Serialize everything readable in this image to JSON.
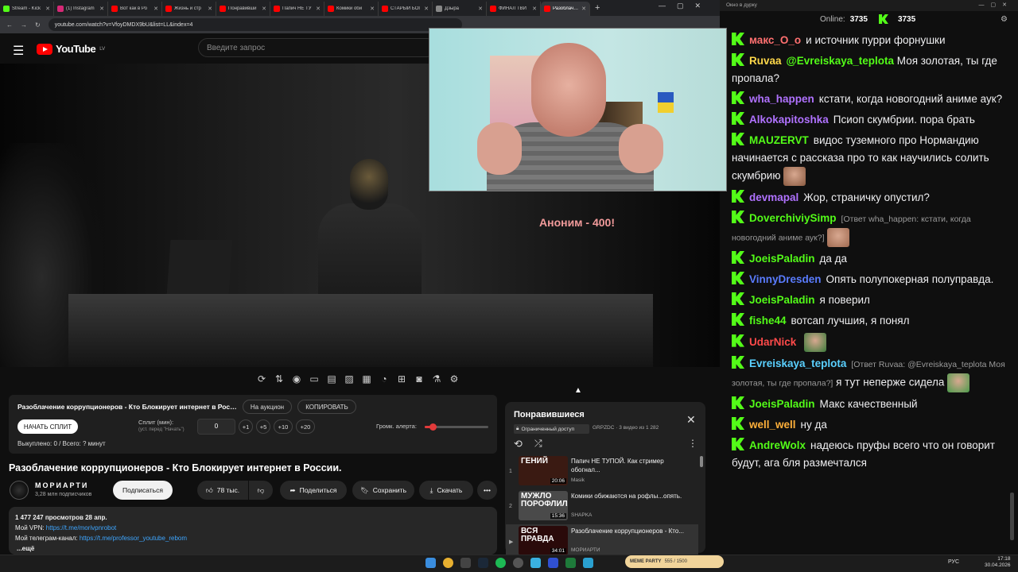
{
  "browser": {
    "tabs": [
      {
        "label": "Stream - Kick",
        "color": "#53fc18"
      },
      {
        "label": "(1) Instagram",
        "color": "#d62976"
      },
      {
        "label": "Вот как в Ро",
        "color": "#f00"
      },
      {
        "label": "Жизнь и стр",
        "color": "#f00"
      },
      {
        "label": "Понравивши",
        "color": "#f00"
      },
      {
        "label": "Папич НЕ ТУ",
        "color": "#f00"
      },
      {
        "label": "Комики оби",
        "color": "#f00"
      },
      {
        "label": "СТАРЫЙ БОГ",
        "color": "#f00"
      },
      {
        "label": "Дзыра",
        "color": "#888"
      },
      {
        "label": "ФИНАЛ ТВИ",
        "color": "#f00"
      },
      {
        "label": "Разоблачени",
        "color": "#f00"
      }
    ],
    "url": "youtube.com/watch?v=VfoyDMDX9bU&list=LL&index=4",
    "window_controls": [
      "—",
      "▢",
      "✕"
    ]
  },
  "youtube": {
    "logo_text": "YouTube",
    "logo_region": "LV",
    "search_placeholder": "Введите запрос"
  },
  "video": {
    "overlay_alert": "Аноним - 400!"
  },
  "split": {
    "title": "Разоблачение коррупционеров - Кто Блокирует интернет в России.",
    "auction_button": "На аукцион",
    "copy_button": "КОПИРОВАТЬ",
    "start_button": "НАЧАТЬ СПЛИТ",
    "split_label": "Сплит (мин):",
    "split_hint": "(уст. перед \"Начать\")",
    "split_value": "0",
    "steps": [
      "+1",
      "+5",
      "+10",
      "+20"
    ],
    "volume_label": "Громк. алерта:",
    "volume_level": 0.12,
    "status": "Выкуплено: 0 / Всего: ? минут"
  },
  "meta": {
    "title": "Разоблачение коррупционеров - Кто Блокирует интернет в России.",
    "channel": "МОРИАРТИ",
    "subscribers": "3,28 млн подписчиков",
    "subscribe": "Подписаться",
    "likes": "78 тыс.",
    "share": "Поделиться",
    "save": "Сохранить",
    "download": "Скачать",
    "more": "•••",
    "views_date": "1 477 247 просмотров  28 апр.",
    "vpn_label": "Мой VPN: ",
    "vpn_link": "https://t.me/morivpnrobot",
    "tg_label": "Мой телеграм-канал: ",
    "tg_link": "https://t.me/professor_youtube_rebom",
    "more_desc": "...ещё"
  },
  "playlist": {
    "title": "Понравившиеся",
    "badge": "Ограниченный доступ",
    "meta": "GRPZDC · 3 видео из 1 282",
    "items": [
      {
        "idx": "1",
        "thumb_text": "ГЕНИЙ",
        "duration": "20:06",
        "title": "Папич НЕ ТУПОЙ. Как стример обогнал...",
        "channel": "Masik",
        "bg": "#3a1a12"
      },
      {
        "idx": "2",
        "thumb_text": "МУЖЛО ПОРОФЛИЛА",
        "duration": "15:36",
        "title": "Комики обижаются на рофлы...опять.",
        "channel": "SHAPKA",
        "bg": "#4a4a4a"
      },
      {
        "idx": "▶",
        "thumb_text": "ВСЯ ПРАВДА",
        "duration": "34:01",
        "title": "Разоблачение коррупционеров - Кто...",
        "channel": "МОРИАРТИ",
        "bg": "#2a0a0a"
      }
    ]
  },
  "chat": {
    "header": "Окно в дурку",
    "online_label": "Online:",
    "online_count": "3735",
    "kick_count": "3735",
    "messages": [
      {
        "user": "макс_О_о",
        "color": "#ff7070",
        "text": "и источник пурри форнушки"
      },
      {
        "user": "Ruvaa",
        "color": "#ffd84a",
        "mention": "@Evreiskaya_teplota",
        "text": "Моя золотая, ты где пропала?"
      },
      {
        "user": "wha_happen",
        "color": "#b072ff",
        "text": "кстати, когда новогодний аниме аук?"
      },
      {
        "user": "Alkokapitoshka",
        "color": "#b072ff",
        "text": "Псиоп скумбрии. пора брать"
      },
      {
        "user": "MAUZERVT",
        "color": "#53fc18",
        "text": "видос туземного про Нормандию начинается с рассказа про то как научились солить скумбрию",
        "emote": "#8a5a40"
      },
      {
        "user": "devmapal",
        "color": "#b072ff",
        "text": "Жор, страничку опустил?"
      },
      {
        "user": "DoverchiviySimp",
        "color": "#53fc18",
        "reply": "[Ответ wha_happen: кстати, когда новогодний аниме аук?]",
        "text": "",
        "emote": "#a06a50"
      },
      {
        "user": "JoeisPaladin",
        "color": "#53fc18",
        "text": "да да"
      },
      {
        "user": "VinnyDresden",
        "color": "#5a7cff",
        "text": "Опять полупокерная полуправда."
      },
      {
        "user": "JoeisPaladin",
        "color": "#53fc18",
        "text": "я поверил"
      },
      {
        "user": "fishe44",
        "color": "#53fc18",
        "text": "вотсап лучшия, я понял"
      },
      {
        "user": "UdarNick",
        "color": "#ff4a4a",
        "text": "",
        "emote": "#3a7a3a"
      },
      {
        "user": "Evreiskaya_teplota",
        "color": "#5ad0ff",
        "reply": "[Ответ Ruvaa: @Evreiskaya_teplota Моя золотая, ты где пропала?]",
        "text": "я тут неперже сидела",
        "emote": "#4a9a4a"
      },
      {
        "user": "JoeisPaladin",
        "color": "#53fc18",
        "text": "Макс качественный"
      },
      {
        "user": "well_well",
        "color": "#ffb03a",
        "text": "ну да"
      },
      {
        "user": "AndreWolx",
        "color": "#53fc18",
        "text": "надеюсь пруфы всего что он говорит будут, ага бля размечтался"
      }
    ]
  },
  "taskbar": {
    "meme_label": "MEME PARTY",
    "meme_value": "555 / 1500",
    "lang": "РУС",
    "time": "17:18",
    "date": "30.04.2026"
  },
  "colors": {
    "kick_green": "#53fc18",
    "yt_red": "#ff0000"
  }
}
